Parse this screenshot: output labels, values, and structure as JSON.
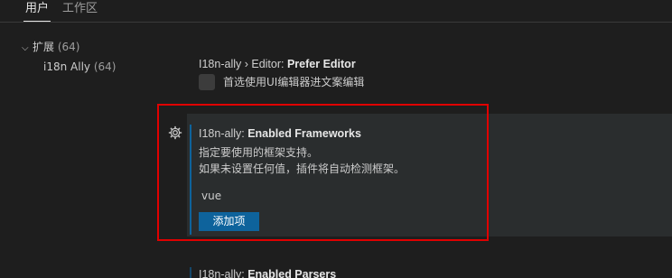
{
  "scope_tabs": {
    "user": "用户",
    "workspace": "工作区"
  },
  "toc": {
    "extensions": {
      "label": "扩展",
      "count": "(64)",
      "expanded": true
    },
    "i18n_ally": {
      "label": "i18n Ally",
      "count": "(64)"
    }
  },
  "settings": {
    "prefer_editor": {
      "category": "I18n-ally › Editor: ",
      "name": "Prefer Editor",
      "checkbox_label": "首选使用UI编辑器进文案编辑",
      "checked": false
    },
    "enabled_frameworks": {
      "category": "I18n-ally: ",
      "name": "Enabled Frameworks",
      "description_line1": "指定要使用的框架支持。",
      "description_line2": "如果未设置任何值，插件将自动检测框架。",
      "items": [
        "vue"
      ],
      "add_button": "添加项"
    },
    "enabled_parsers": {
      "category": "I18n-ally: ",
      "name": "Enabled Parsers"
    }
  },
  "colors": {
    "background": "#1e1e1e",
    "focused_row": "#2a2d2e",
    "accent": "#0e639c",
    "annotation": "#e00000"
  },
  "icons": {
    "chevron": "chevron-down-icon",
    "gear": "gear-icon"
  }
}
